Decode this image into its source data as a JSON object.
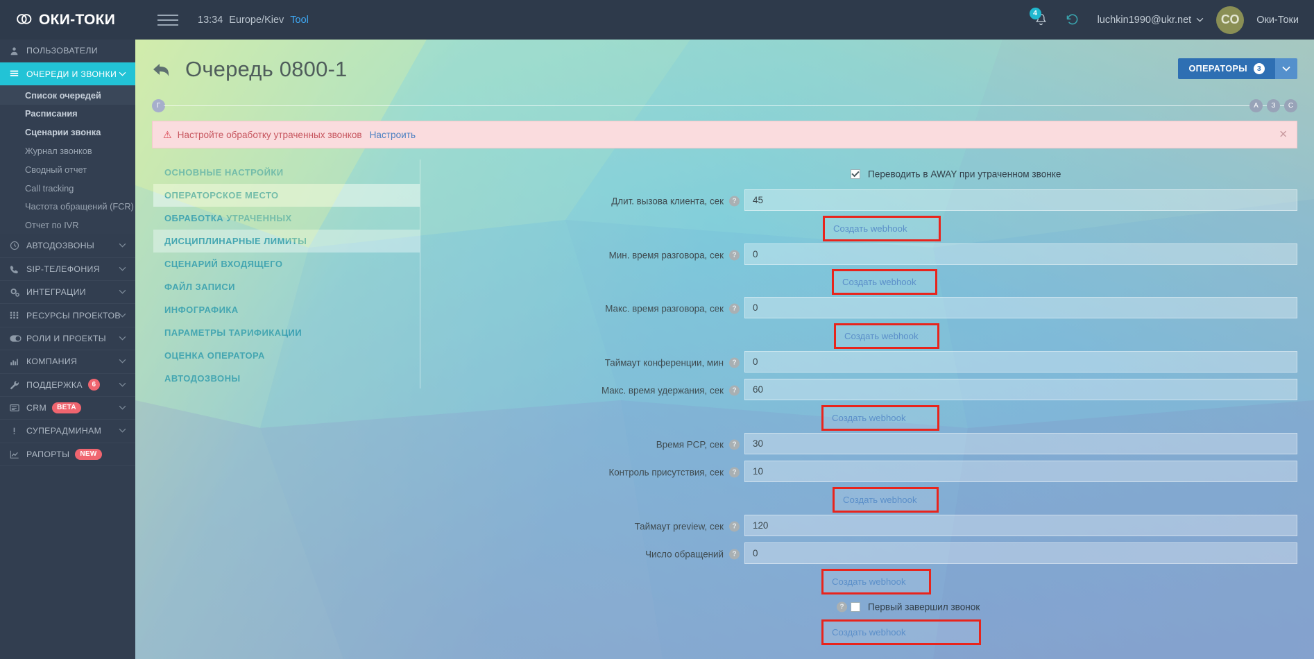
{
  "topbar": {
    "brand": "ОКИ-ТОКИ",
    "menu_icon": "hamburger-icon",
    "time": "13:34",
    "timezone": "Europe/Kiev",
    "tool_label": "Tool",
    "bell_icon": "bell-icon",
    "bell_count": "4",
    "history_icon": "history-icon",
    "user_email": "luchkin1990@ukr.net",
    "avatar_initials": "СО",
    "company": "Оки-Токи"
  },
  "sidebar": {
    "items": [
      {
        "label": "ПОЛЬЗОВАТЕЛИ",
        "icon": "user-icon",
        "active": false,
        "chevron": false
      },
      {
        "label": "ОЧЕРЕДИ И ЗВОНКИ",
        "icon": "list-icon",
        "active": true,
        "chevron": true
      }
    ],
    "subitems": [
      {
        "label": "Список очередей",
        "bold": true,
        "current": true
      },
      {
        "label": "Расписания",
        "bold": true,
        "current": false
      },
      {
        "label": "Сценарии звонка",
        "bold": true,
        "current": false
      },
      {
        "label": "Журнал звонков",
        "bold": false,
        "current": false
      },
      {
        "label": "Сводный отчет",
        "bold": false,
        "current": false
      },
      {
        "label": "Call tracking",
        "bold": false,
        "current": false
      },
      {
        "label": "Частота обращений (FCR)",
        "bold": false,
        "current": false
      },
      {
        "label": "Отчет по IVR",
        "bold": false,
        "current": false
      }
    ],
    "items2": [
      {
        "label": "АВТОДОЗВОНЫ",
        "icon": "clock-icon",
        "chevron": true,
        "badge": null,
        "badge_type": null
      },
      {
        "label": "SIP-ТЕЛЕФОНИЯ",
        "icon": "phone-icon",
        "chevron": true,
        "badge": null,
        "badge_type": null
      },
      {
        "label": "ИНТЕГРАЦИИ",
        "icon": "gears-icon",
        "chevron": true,
        "badge": null,
        "badge_type": null
      },
      {
        "label": "РЕСУРСЫ ПРОЕКТОВ",
        "icon": "grid-icon",
        "chevron": true,
        "badge": null,
        "badge_type": null
      },
      {
        "label": "РОЛИ И ПРОЕКТЫ",
        "icon": "toggle-icon",
        "chevron": true,
        "badge": null,
        "badge_type": null
      },
      {
        "label": "КОМПАНИЯ",
        "icon": "bar-chart-icon",
        "chevron": true,
        "badge": null,
        "badge_type": null
      },
      {
        "label": "ПОДДЕРЖКА",
        "icon": "wrench-icon",
        "chevron": true,
        "badge": "6",
        "badge_type": "round"
      },
      {
        "label": "CRM",
        "icon": "card-icon",
        "chevron": true,
        "badge": "BETA",
        "badge_type": "pill"
      },
      {
        "label": "СУПЕРАДМИНАМ",
        "icon": "exclaim-icon",
        "chevron": true,
        "badge": null,
        "badge_type": null
      },
      {
        "label": "РАПОРТЫ",
        "icon": "trend-icon",
        "chevron": false,
        "badge": "NEW",
        "badge_type": "pill"
      }
    ]
  },
  "page": {
    "back_icon": "back-arrow-icon",
    "title": "Очередь 0800-1",
    "operators_label": "ОПЕРАТОРЫ",
    "operators_count": "3",
    "operators_caret_icon": "chevron-down-icon",
    "letter_chip": "Г",
    "right_chips": [
      "А",
      "З",
      "С"
    ]
  },
  "alert": {
    "warn_icon": "warning-icon",
    "text": "Настройте обработку утраченных звонков",
    "link": "Настроить",
    "close_icon": "close-icon"
  },
  "tabs": [
    {
      "label": "ОСНОВНЫЕ НАСТРОЙКИ",
      "state": "normal"
    },
    {
      "label": "ОПЕРАТОРСКОЕ МЕСТО",
      "state": "sel"
    },
    {
      "label": "ОБРАБОТКА УТРАЧЕННЫХ",
      "state": "normal"
    },
    {
      "label": "ДИСЦИПЛИНАРНЫЕ ЛИМИТЫ",
      "state": "sel2"
    },
    {
      "label": "СЦЕНАРИЙ ВХОДЯЩЕГО",
      "state": "normal"
    },
    {
      "label": "ФАЙЛ ЗАПИСИ",
      "state": "normal"
    },
    {
      "label": "ИНФОГРАФИКА",
      "state": "normal"
    },
    {
      "label": "ПАРАМЕТРЫ ТАРИФИКАЦИИ",
      "state": "normal"
    },
    {
      "label": "ОЦЕНКА ОПЕРАТОРА",
      "state": "normal"
    },
    {
      "label": "АВТОДОЗВОНЫ",
      "state": "normal"
    }
  ],
  "form": {
    "away_checkbox_label": "Переводить в AWAY при утраченном звонке",
    "away_checked": true,
    "last_checkbox_label": "Первый завершил звонок",
    "last_checked": false,
    "webhook_label": "Создать webhook",
    "fields": [
      {
        "label": "Длит. вызова клиента, сек",
        "value": "45"
      },
      {
        "label": "Мин. время разговора, сек",
        "value": "0"
      },
      {
        "label": "Макс. время разговора, сек",
        "value": "0"
      },
      {
        "label": "Таймаут конференции, мин",
        "value": "0"
      },
      {
        "label": "Макс. время удержания, сек",
        "value": "60"
      },
      {
        "label": "Время PCP, сек",
        "value": "30"
      },
      {
        "label": "Контроль присутствия, сек",
        "value": "10"
      },
      {
        "label": "Таймаут preview, сек",
        "value": "120"
      },
      {
        "label": "Число обращений",
        "value": "0"
      }
    ]
  },
  "colors": {
    "accent": "#22c3d6",
    "sidebar_bg": "#323e50",
    "topbar_bg": "#2e3a4b",
    "tab_text": "#2293a8",
    "ops_blue": "#2e6fb3",
    "highlight_red": "#e8241c",
    "alert_bg": "#fadcde",
    "badge_red": "#f0656f"
  }
}
